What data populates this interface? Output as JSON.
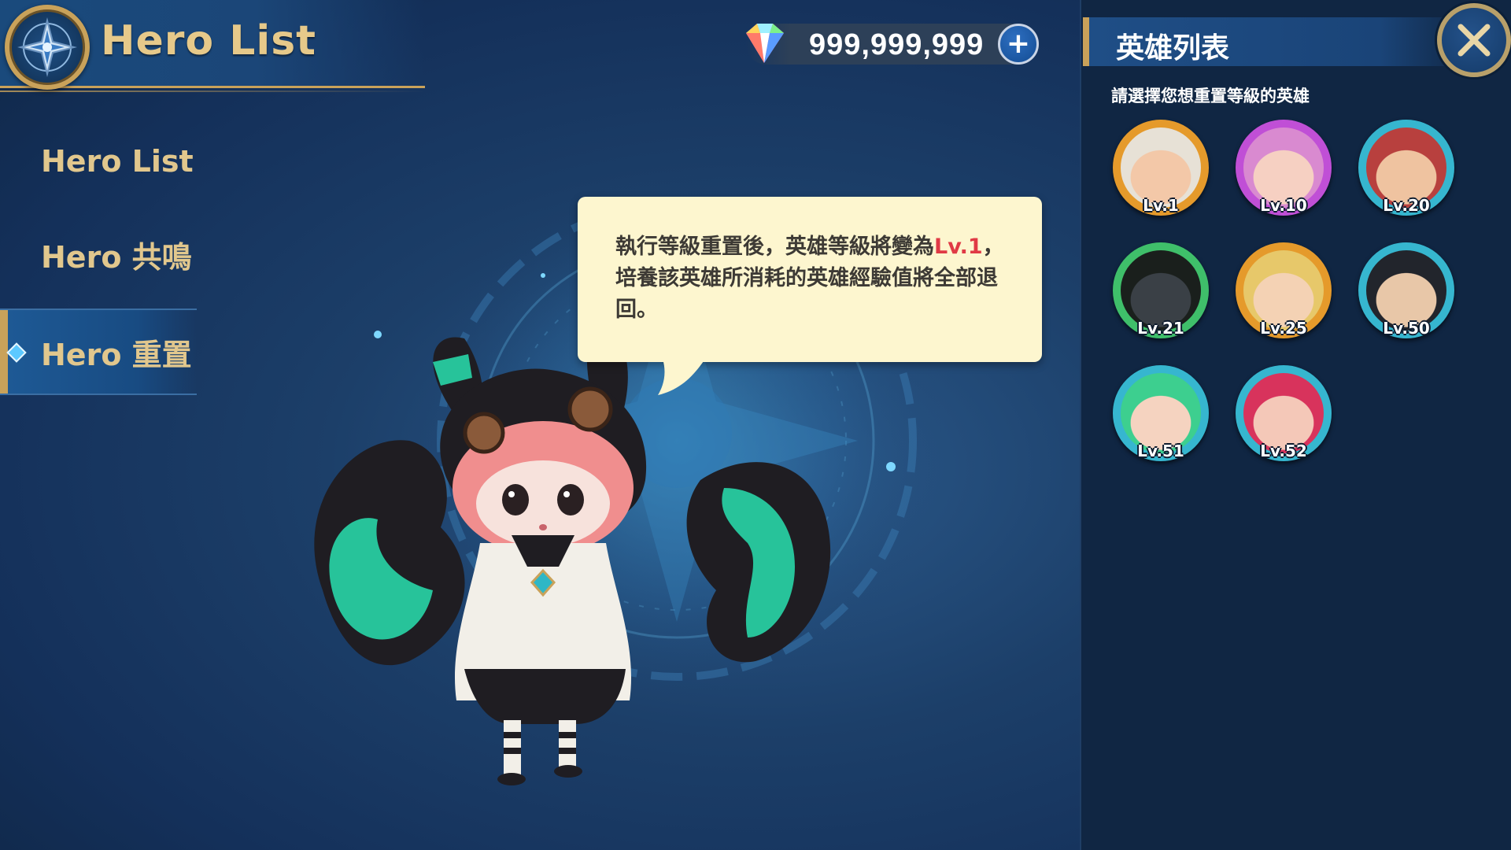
{
  "header": {
    "title": "Hero List",
    "emblem_icon": "compass-emblem-icon"
  },
  "currency": {
    "icon": "rainbow-gem-icon",
    "value": "999,999,999",
    "add_label": "+"
  },
  "nav": {
    "items": [
      {
        "label": "Hero List",
        "active": false
      },
      {
        "label": "Hero 共鳴",
        "active": false
      },
      {
        "label": "Hero 重置",
        "active": true
      }
    ]
  },
  "dialog": {
    "text_before": "執行等級重置後，英雄等級將變為",
    "highlight": "Lv.1",
    "text_after": "，培養該英雄所消耗的英雄經驗值將全部退回。"
  },
  "panel": {
    "title": "英雄列表",
    "subtitle": "請選擇您想重置等級的英雄",
    "close_icon": "close-x-icon",
    "heroes": [
      {
        "level": "Lv.1",
        "ring": "#e59a2b"
      },
      {
        "level": "Lv.10",
        "ring": "#c04fd6"
      },
      {
        "level": "Lv.20",
        "ring": "#36b6cf"
      },
      {
        "level": "Lv.21",
        "ring": "#3fbf6a"
      },
      {
        "level": "Lv.25",
        "ring": "#e59a2b"
      },
      {
        "level": "Lv.50",
        "ring": "#36b6cf"
      },
      {
        "level": "Lv.51",
        "ring": "#36b6cf"
      },
      {
        "level": "Lv.52",
        "ring": "#36b6cf"
      }
    ]
  },
  "colors": {
    "gold": "#c9a25a",
    "highlight_red": "#e03a45",
    "dialog_bg": "#fdf6cf"
  }
}
